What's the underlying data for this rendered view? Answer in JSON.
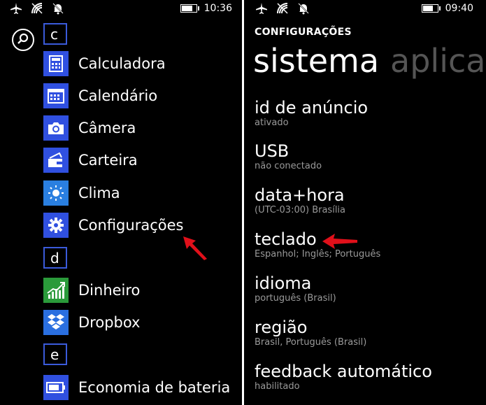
{
  "left": {
    "status": {
      "time": "10:36",
      "battery_level": 0.85
    },
    "groups": [
      {
        "letter": "c"
      },
      {
        "letter": "d"
      },
      {
        "letter": "e"
      }
    ],
    "apps": {
      "calculadora": "Calculadora",
      "calendario": "Calendário",
      "camera": "Câmera",
      "carteira": "Carteira",
      "clima": "Clima",
      "configuracoes": "Configurações",
      "dinheiro": "Dinheiro",
      "dropbox": "Dropbox",
      "economia": "Economia de bateria"
    },
    "icons": [
      "search-icon",
      "calculator-icon",
      "calendar-icon",
      "camera-icon",
      "wallet-icon",
      "weather-icon",
      "gear-icon",
      "chart-icon",
      "dropbox-icon",
      "battery-saver-icon"
    ],
    "accent_color": "#3050e0",
    "pointer_color": "#e0101a"
  },
  "right": {
    "status": {
      "time": "09:40",
      "battery_level": 0.75
    },
    "header": "CONFIGURAÇÕES",
    "tabs": {
      "active": "sistema",
      "next": "aplicat"
    },
    "settings": [
      {
        "name": "id de anúncio",
        "sub": "ativado"
      },
      {
        "name": "USB",
        "sub": "não conectado"
      },
      {
        "name": "data+hora",
        "sub": "(UTC-03:00) Brasília"
      },
      {
        "name": "teclado",
        "sub": "Espanhol; Inglês; Português"
      },
      {
        "name": "idioma",
        "sub": "português (Brasil)"
      },
      {
        "name": "região",
        "sub": "Brasil, Português (Brasil)"
      },
      {
        "name": "feedback automático",
        "sub": "habilitado"
      }
    ]
  }
}
